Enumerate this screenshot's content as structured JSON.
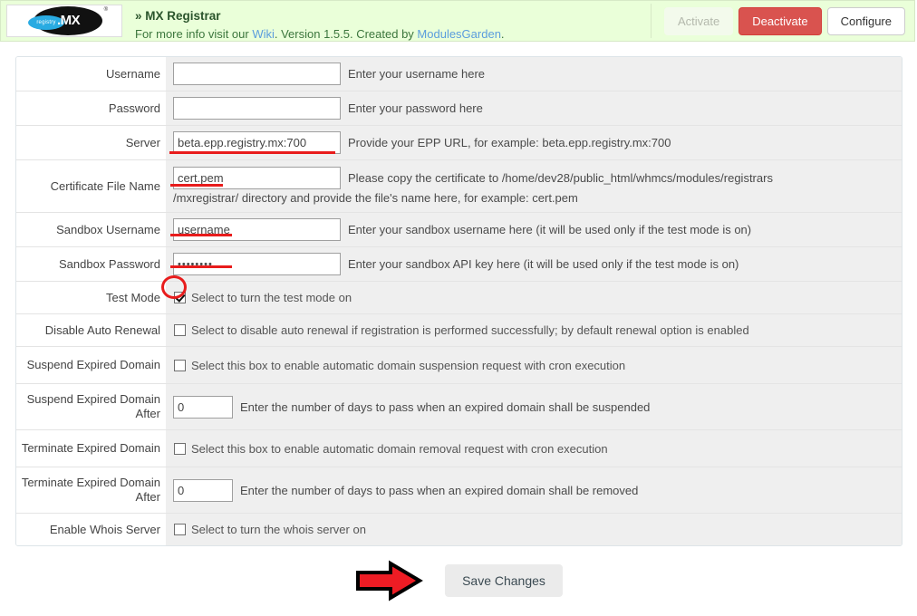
{
  "header": {
    "logo": {
      "brand_text": ".MX",
      "badge_text": "registry",
      "tm": "®"
    },
    "title": "» MX Registrar",
    "subtitle_pre": "For more info visit our ",
    "link_wiki": "Wiki",
    "subtitle_mid": ". Version 1.5.5. Created by ",
    "link_author": "ModulesGarden",
    "subtitle_end": ".",
    "buttons": {
      "activate": "Activate",
      "deactivate": "Deactivate",
      "configure": "Configure"
    },
    "colors": {
      "bg": "#eaffd9",
      "border": "#d6e9c6",
      "deactivate_bg": "#d9534f",
      "link": "#5b9ddd"
    }
  },
  "form": {
    "rows": [
      {
        "label": "Username",
        "field": "text",
        "value": "",
        "hint": "Enter your username here"
      },
      {
        "label": "Password",
        "field": "text",
        "value": "",
        "hint": "Enter your password here"
      },
      {
        "label": "Server",
        "field": "text",
        "value": "beta.epp.registry.mx:700",
        "hint": "Provide your EPP URL, for example: beta.epp.registry.mx:700"
      },
      {
        "label": "Certificate File Name",
        "field": "text",
        "value": "cert.pem",
        "hint": "Please copy the certificate to /home/dev28/public_html/whmcs/modules/registrars",
        "hint2": "/mxregistrar/ directory and provide the file's name here, for example: cert.pem"
      },
      {
        "label": "Sandbox Username",
        "field": "text",
        "value": "username",
        "hint": "Enter your sandbox username here (it will be used only if the test mode is on)"
      },
      {
        "label": "Sandbox Password",
        "field": "password",
        "value": "••••••••",
        "hint": "Enter your sandbox API key here (it will be used only if the test mode is on)"
      },
      {
        "label": "Test Mode",
        "field": "checkbox",
        "checked": true,
        "hint": "Select to turn the test mode on"
      },
      {
        "label": "Disable Auto Renewal",
        "field": "checkbox",
        "checked": false,
        "hint": "Select to disable auto renewal if registration is performed successfully; by default renewal option is enabled"
      },
      {
        "label": "Suspend Expired Domain",
        "field": "checkbox",
        "checked": false,
        "hint": "Select this box to enable automatic domain suspension request with cron execution"
      },
      {
        "label": "Suspend Expired Domain After",
        "field": "number",
        "value": "0",
        "hint": "Enter the number of days to pass when an expired domain shall be suspended"
      },
      {
        "label": "Terminate Expired Domain",
        "field": "checkbox",
        "checked": false,
        "hint": "Select this box to enable automatic domain removal request with cron execution"
      },
      {
        "label": "Terminate Expired Domain After",
        "field": "number",
        "value": "0",
        "hint": "Enter the number of days to pass when an expired domain shall be removed"
      },
      {
        "label": "Enable Whois Server",
        "field": "checkbox",
        "checked": false,
        "hint": "Select to turn the whois server on"
      }
    ]
  },
  "footer": {
    "save_label": "Save Changes"
  },
  "annotations": {
    "color": "#e81c1c",
    "underlines": [
      "server-value",
      "certificate-value",
      "sandbox-username-value",
      "sandbox-password-value"
    ],
    "circle": "test-mode-checkbox",
    "arrow": "points-to-save-changes"
  }
}
